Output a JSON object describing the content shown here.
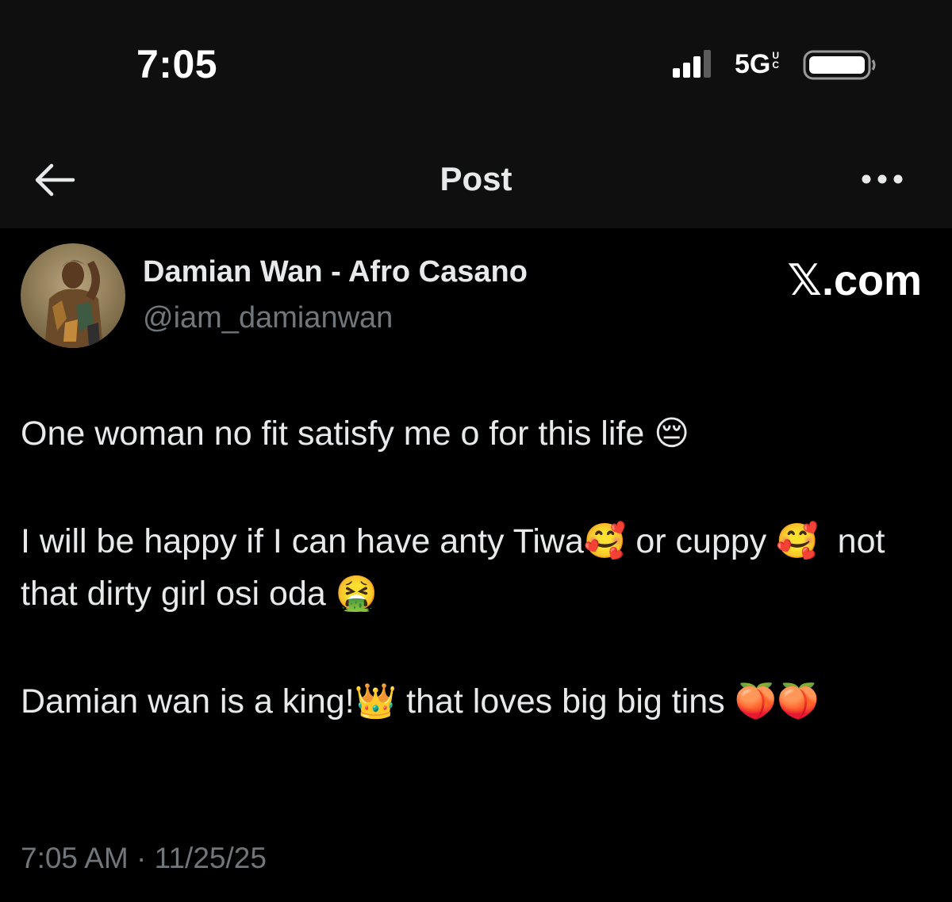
{
  "status_bar": {
    "time": "7:05",
    "network": "5G",
    "network_suffix": "UC",
    "signal_icon": "signal-bars-icon",
    "battery_icon": "battery-icon"
  },
  "header": {
    "title": "Post",
    "back_icon": "arrow-left-icon",
    "more_icon": "more-horizontal-icon"
  },
  "author": {
    "name": "Damian Wan - Afro Casano",
    "handle": "@iam_damianwan"
  },
  "watermark": "𝕏.com",
  "post": {
    "paragraphs": [
      "One woman no fit satisfy me o for this life 😔",
      "I will be happy if I can have anty Tiwa🥰 or cuppy 🥰  not that dirty girl osi oda 🤮",
      "Damian wan is a king!👑 that loves big big tins 🍑🍑"
    ]
  },
  "timestamp": "7:05 AM · 11/25/25",
  "colors": {
    "background": "#000000",
    "header_background": "#0f0f0f",
    "text_primary": "#e7e9ea",
    "text_secondary": "#71767b"
  }
}
